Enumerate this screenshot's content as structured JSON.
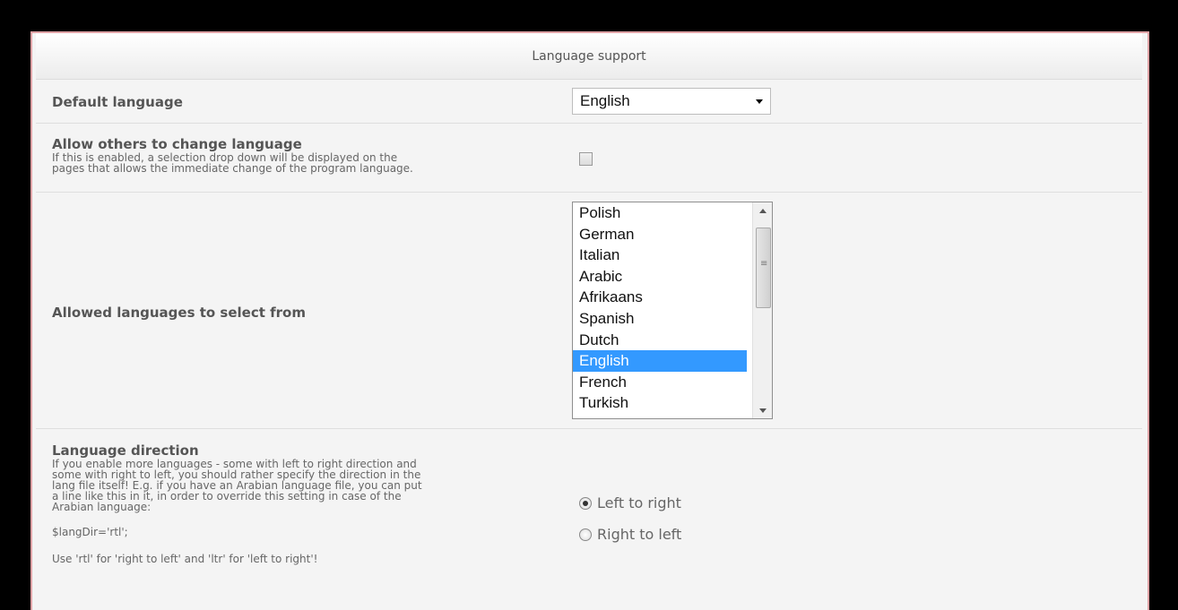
{
  "header": {
    "title": "Language support"
  },
  "default_language": {
    "label": "Default language",
    "value": "English"
  },
  "allow_change": {
    "label": "Allow others to change language",
    "desc_line1": "If this is enabled, a selection drop down will be displayed on the",
    "desc_line2": "pages that allows the immediate change of the program language.",
    "checked": false
  },
  "allowed_languages": {
    "label": "Allowed languages to select from",
    "options": [
      "Polish",
      "German",
      "Italian",
      "Arabic",
      "Afrikaans",
      "Spanish",
      "Dutch",
      "English",
      "French",
      "Turkish"
    ],
    "selected": "English"
  },
  "direction": {
    "label": "Language direction",
    "desc_lines": [
      "If you enable more languages - some with left to right direction and",
      "some with right to left, you should rather specify the direction in the",
      "lang file itself! E.g. if you have an Arabian language file, you can put",
      "a line like this in it, in order to override this setting in case of the",
      "Arabian language:"
    ],
    "code": "$langDir='rtl';",
    "note": "Use 'rtl' for 'right to left' and 'ltr' for 'left to right'!",
    "options": [
      {
        "label": "Left to right",
        "checked": true
      },
      {
        "label": "Right to left",
        "checked": false
      }
    ]
  }
}
